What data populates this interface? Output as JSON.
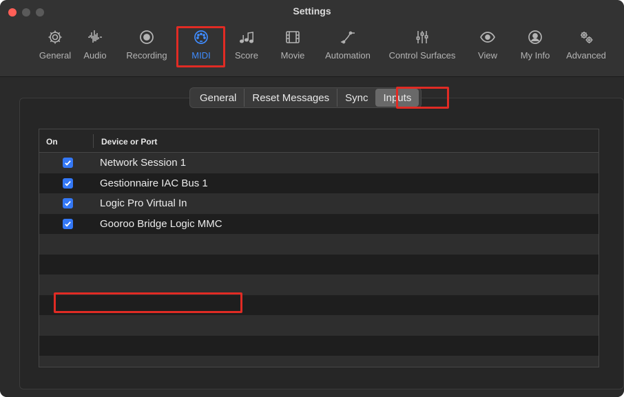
{
  "window": {
    "title": "Settings"
  },
  "toolbar": {
    "items": [
      {
        "label": "General",
        "icon": "gear-icon"
      },
      {
        "label": "Audio",
        "icon": "waveform-icon"
      },
      {
        "label": "Recording",
        "icon": "record-icon"
      },
      {
        "label": "MIDI",
        "icon": "midi-connector-icon",
        "active": true
      },
      {
        "label": "Score",
        "icon": "music-notes-icon"
      },
      {
        "label": "Movie",
        "icon": "film-icon"
      },
      {
        "label": "Automation",
        "icon": "automation-curve-icon"
      },
      {
        "label": "Control Surfaces",
        "icon": "faders-icon"
      },
      {
        "label": "View",
        "icon": "eye-icon"
      },
      {
        "label": "My Info",
        "icon": "person-icon"
      },
      {
        "label": "Advanced",
        "icon": "gears-icon"
      }
    ]
  },
  "tabs": [
    {
      "label": "General"
    },
    {
      "label": "Reset Messages"
    },
    {
      "label": "Sync"
    },
    {
      "label": "Inputs",
      "active": true
    }
  ],
  "table": {
    "headers": {
      "on": "On",
      "device": "Device or Port"
    },
    "rows": [
      {
        "checked": true,
        "label": "Network Session 1"
      },
      {
        "checked": true,
        "label": "Gestionnaire IAC Bus 1"
      },
      {
        "checked": true,
        "label": "Logic Pro Virtual In"
      },
      {
        "checked": true,
        "label": "Gooroo Bridge Logic MMC"
      }
    ]
  },
  "colors": {
    "accent": "#3f8cff",
    "checkbox": "#3478f6",
    "highlight": "#e12b24",
    "close": "#ff5f57"
  }
}
